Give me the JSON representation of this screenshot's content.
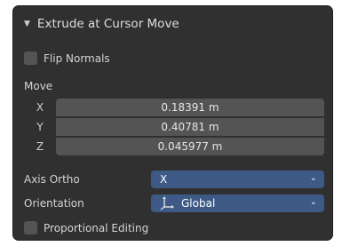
{
  "panel": {
    "title": "Extrude at Cursor Move",
    "flip_normals": {
      "label": "Flip Normals",
      "checked": false
    },
    "move_label": "Move",
    "move": [
      {
        "axis": "X",
        "value": "0.18391 m"
      },
      {
        "axis": "Y",
        "value": "0.40781 m"
      },
      {
        "axis": "Z",
        "value": "0.045977 m"
      }
    ],
    "axis_ortho": {
      "label": "Axis Ortho",
      "value": "X"
    },
    "orientation": {
      "label": "Orientation",
      "value": "Global",
      "icon": "orientation-gizmo-icon"
    },
    "proportional_editing": {
      "label": "Proportional Editing",
      "checked": false
    }
  },
  "colors": {
    "panel_bg": "#303030",
    "field_bg": "#545454",
    "dropdown_bg": "#3d5a86",
    "text": "#d8d8d8"
  }
}
